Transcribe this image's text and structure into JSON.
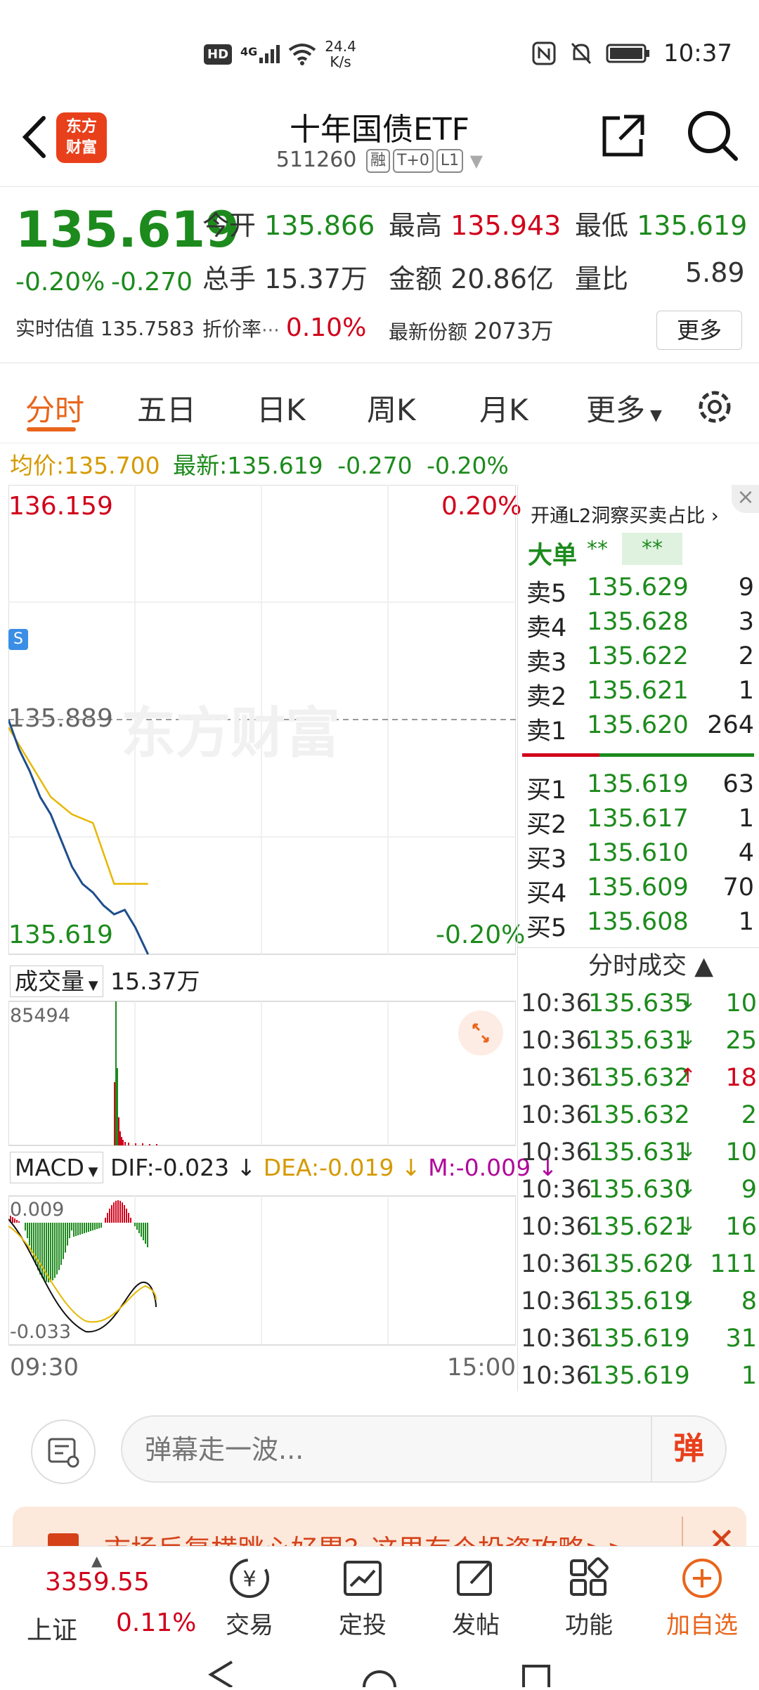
{
  "status": {
    "speed_top": "24.4",
    "speed_bottom": "K/s",
    "time": "10:37",
    "net": "4G"
  },
  "header": {
    "logo_line1": "东方",
    "logo_line2": "财富",
    "title": "十年国债ETF",
    "code": "511260",
    "tags": [
      "融",
      "T+0",
      "L1"
    ]
  },
  "quote": {
    "price": "135.619",
    "change_pct": "-0.20%",
    "change_abs": "-0.270",
    "open_label": "今开",
    "open": "135.866",
    "high_label": "最高",
    "high": "135.943",
    "low_label": "最低",
    "low": "135.619",
    "vol_label": "总手",
    "vol": "15.37万",
    "amount_label": "金额",
    "amount": "20.86亿",
    "ratio_label": "量比",
    "ratio": "5.89",
    "iopv_label": "实时估值",
    "iopv": "135.7583",
    "discount_label": "折价率",
    "discount": "0.10%",
    "shares_label": "最新份额",
    "shares": "2073万",
    "more": "更多"
  },
  "tabs": [
    "分时",
    "五日",
    "日K",
    "周K",
    "月K",
    "更多"
  ],
  "avg": {
    "avg_label": "均价:",
    "avg": "135.700",
    "latest_label": "最新:",
    "latest": "135.619",
    "chg": "-0.270",
    "pct": "-0.20%"
  },
  "chart": {
    "price_top": "136.159",
    "pct_top": "0.20%",
    "price_mid": "135.889",
    "price_bottom": "135.619",
    "pct_bottom": "-0.20%",
    "s_marker": "S",
    "volume_label": "成交量",
    "volume_total": "15.37万",
    "volume_max": "85494",
    "macd_label": "MACD",
    "dif": "DIF:-0.023",
    "dea": "DEA:-0.019",
    "m": "M:-0.009",
    "macd_top": "0.009",
    "macd_bottom": "-0.033",
    "time_start": "09:30",
    "time_end": "15:00",
    "watermark": "东方财富",
    "colors": {
      "price": "#1f4e8c",
      "avg": "#e6b800",
      "up": "#d0021b",
      "down": "#1c8a1c"
    }
  },
  "chart_data": {
    "type": "line",
    "series": [
      {
        "name": "最新",
        "x": [
          "09:30",
          "09:35",
          "09:40",
          "09:45",
          "09:50",
          "09:55",
          "10:00",
          "10:05",
          "10:10",
          "10:15",
          "10:20",
          "10:25",
          "10:30",
          "10:36"
        ],
        "values": [
          135.889,
          135.855,
          135.83,
          135.8,
          135.78,
          135.75,
          135.72,
          135.7,
          135.69,
          135.675,
          135.665,
          135.67,
          135.65,
          135.619
        ]
      },
      {
        "name": "均价",
        "x": [
          "09:30",
          "09:40",
          "09:50",
          "10:00",
          "10:10",
          "10:20",
          "10:30",
          "10:36"
        ],
        "values": [
          135.88,
          135.84,
          135.8,
          135.78,
          135.77,
          135.7,
          135.7,
          135.7
        ]
      }
    ],
    "ylim": [
      135.619,
      136.159
    ]
  },
  "orderbook": {
    "l2_banner": "开通L2洞察买卖占比",
    "big_label": "大单",
    "big_v1": "**",
    "big_v2": "**",
    "asks": [
      {
        "label": "卖5",
        "price": "135.629",
        "vol": "9"
      },
      {
        "label": "卖4",
        "price": "135.628",
        "vol": "3"
      },
      {
        "label": "卖3",
        "price": "135.622",
        "vol": "2"
      },
      {
        "label": "卖2",
        "price": "135.621",
        "vol": "1"
      },
      {
        "label": "卖1",
        "price": "135.620",
        "vol": "264"
      }
    ],
    "bids": [
      {
        "label": "买1",
        "price": "135.619",
        "vol": "63"
      },
      {
        "label": "买2",
        "price": "135.617",
        "vol": "1"
      },
      {
        "label": "买3",
        "price": "135.610",
        "vol": "4"
      },
      {
        "label": "买4",
        "price": "135.609",
        "vol": "70"
      },
      {
        "label": "买5",
        "price": "135.608",
        "vol": "1"
      }
    ],
    "ticks_title": "分时成交",
    "ticks": [
      {
        "t": "10:36",
        "p": "135.635",
        "d": "↓",
        "v": "10"
      },
      {
        "t": "10:36",
        "p": "135.631",
        "d": "↓",
        "v": "25"
      },
      {
        "t": "10:36",
        "p": "135.632",
        "d": "↑",
        "v": "18"
      },
      {
        "t": "10:36",
        "p": "135.632",
        "d": "",
        "v": "2"
      },
      {
        "t": "10:36",
        "p": "135.631",
        "d": "↓",
        "v": "10"
      },
      {
        "t": "10:36",
        "p": "135.630",
        "d": "↓",
        "v": "9"
      },
      {
        "t": "10:36",
        "p": "135.621",
        "d": "↓",
        "v": "16"
      },
      {
        "t": "10:36",
        "p": "135.620",
        "d": "↓",
        "v": "111"
      },
      {
        "t": "10:36",
        "p": "135.619",
        "d": "↓",
        "v": "8"
      },
      {
        "t": "10:36",
        "p": "135.619",
        "d": "",
        "v": "31"
      },
      {
        "t": "10:36",
        "p": "135.619",
        "d": "",
        "v": "1"
      }
    ]
  },
  "comment": {
    "placeholder": "弹幕走一波...",
    "danmu": "弹"
  },
  "banner": {
    "text": "市场反复横跳心好累？这里有个投资攻略>>"
  },
  "bottomnav": {
    "index_value": "3359.55",
    "index_name": "上证",
    "index_pct": "0.11%",
    "items": [
      "交易",
      "定投",
      "发帖",
      "功能",
      "加自选"
    ]
  }
}
